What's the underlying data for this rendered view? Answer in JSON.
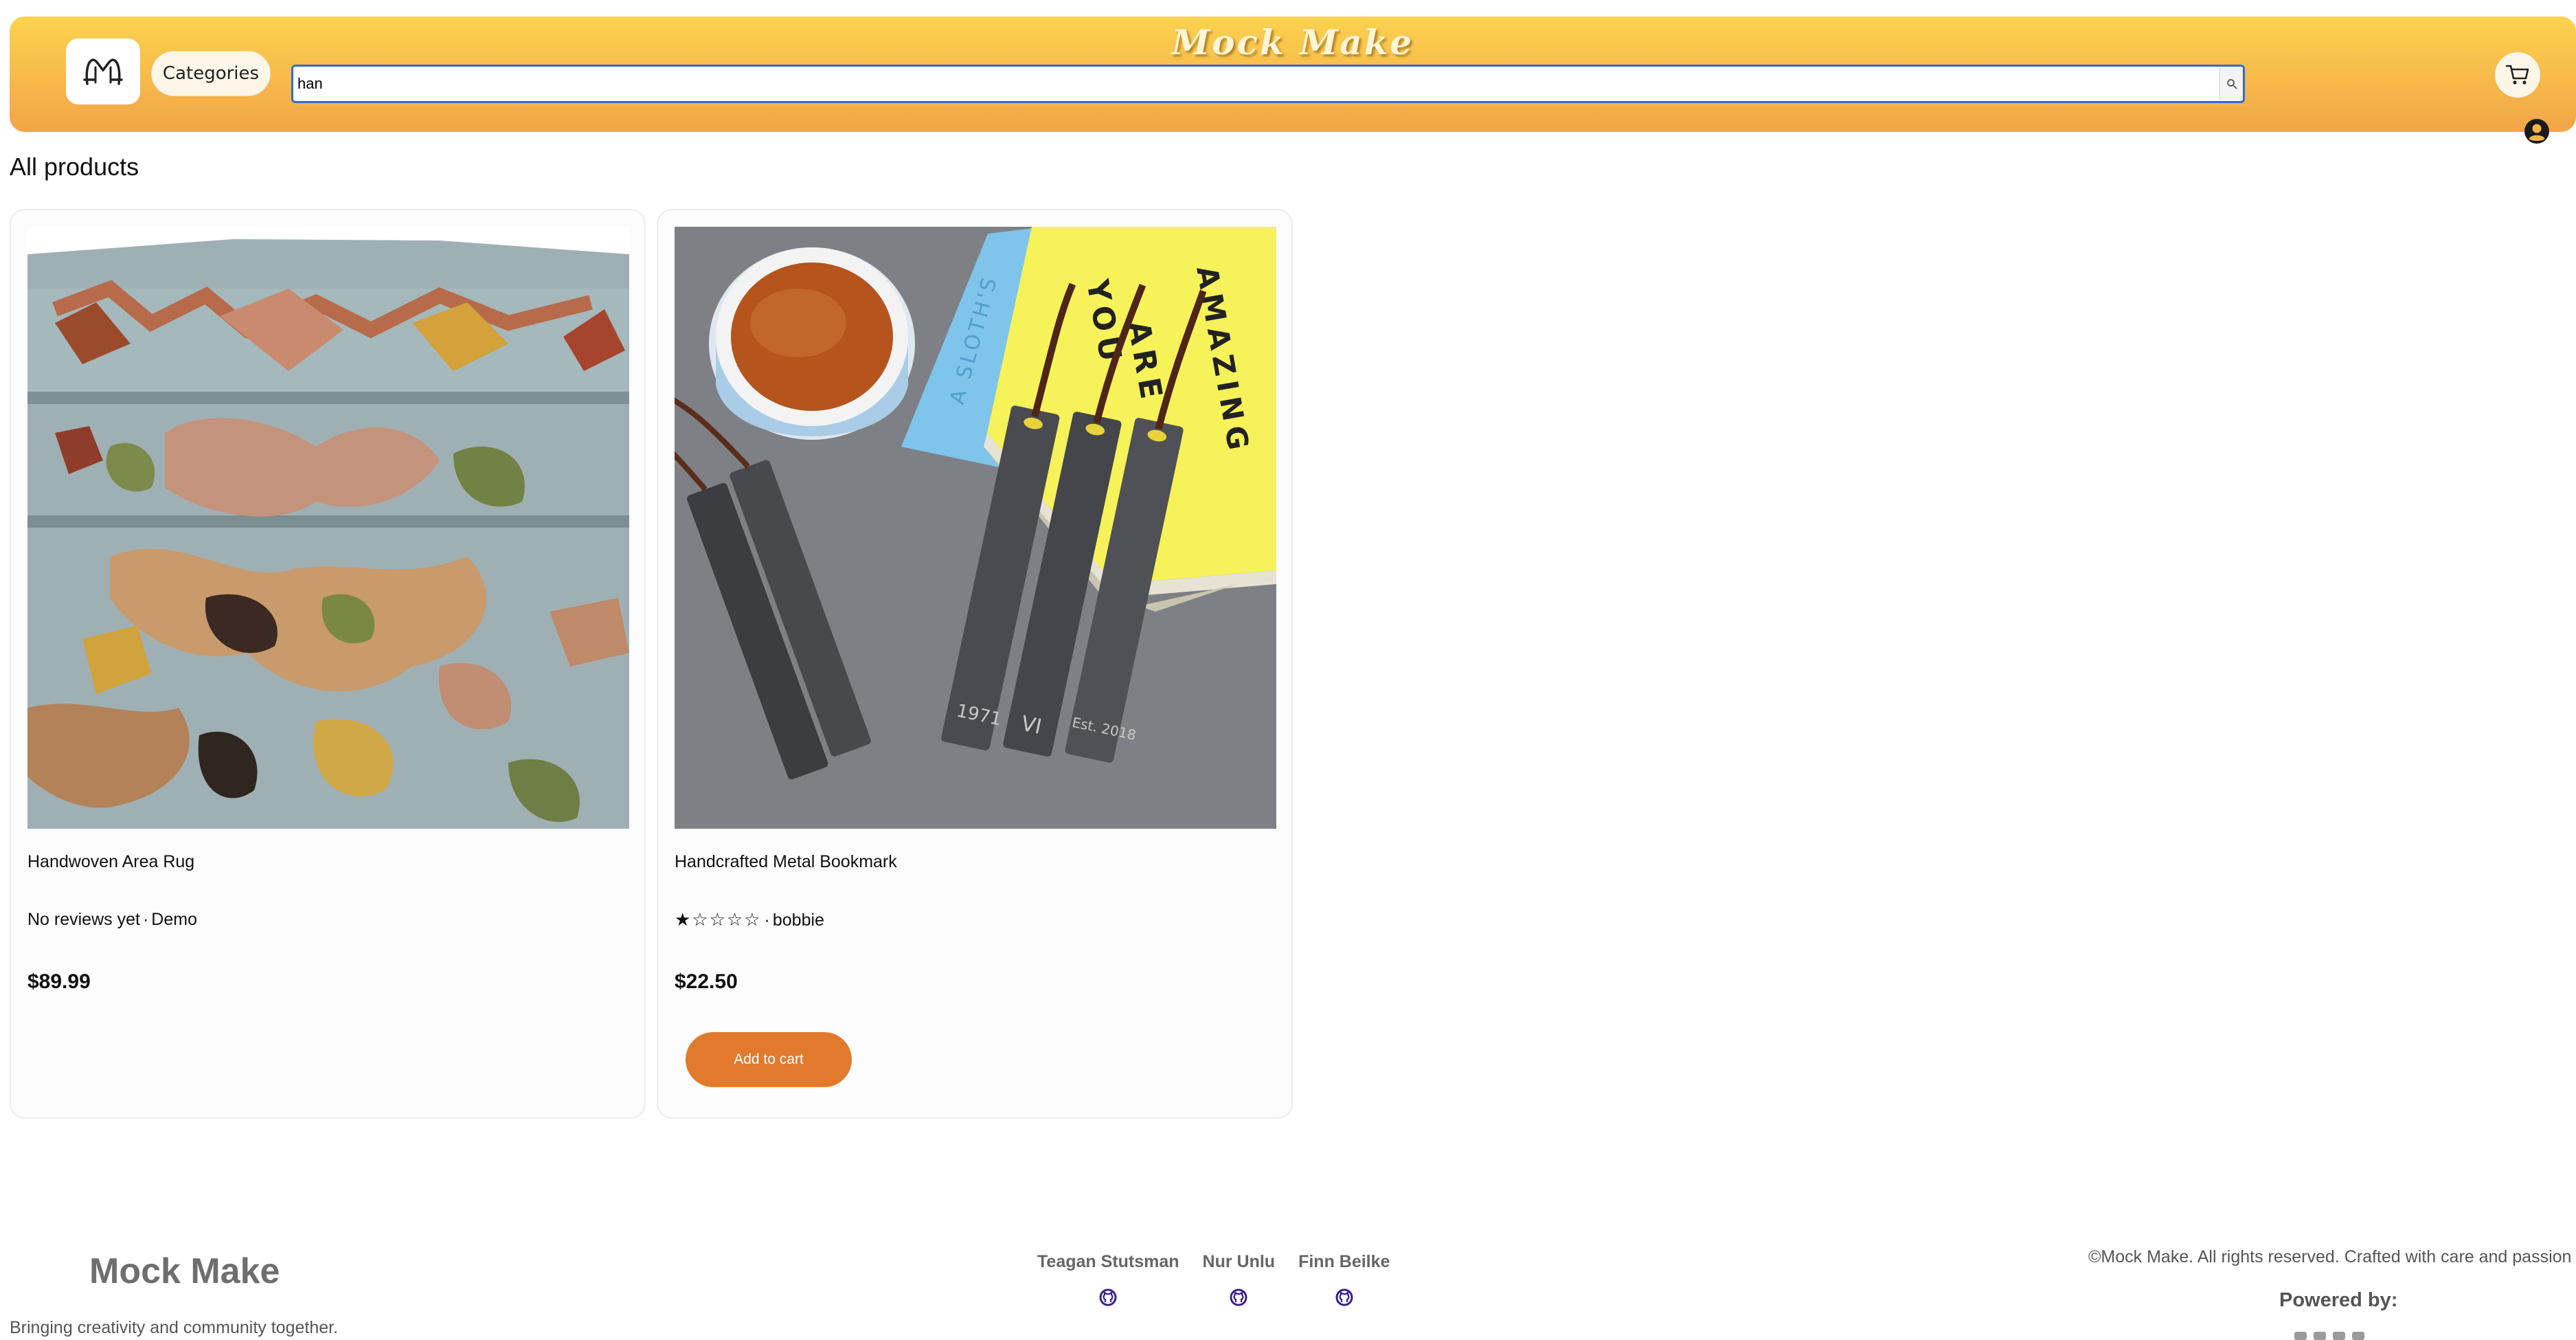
{
  "header": {
    "brand_title": "Mock Make",
    "categories_label": "Categories",
    "search": {
      "value": "han",
      "placeholder": ""
    },
    "icons": {
      "logo": "mock-make-logo",
      "search": "search-icon",
      "cart": "cart-icon",
      "user": "user-circle-icon"
    },
    "gradient": [
      "#fbd34f",
      "#f2a548"
    ]
  },
  "main": {
    "title": "All products",
    "products": [
      {
        "name": "Handwoven Area Rug",
        "reviews": "No reviews yet",
        "seller": "Demo",
        "separator": "·",
        "price": "$89.99",
        "image_icon": "rug-photo"
      },
      {
        "name": "Handcrafted Metal Bookmark",
        "rating": 1,
        "rating_max": 5,
        "stars": "★☆☆☆☆",
        "seller": "bobbie",
        "separator": "·",
        "price": "$22.50",
        "add_to_cart_label": "Add to cart",
        "image_icon": "bookmark-photo",
        "image_text": [
          "YOU",
          "ARE",
          "AMAZING",
          "A SLOTH'S",
          "1971",
          "VI",
          "Est. 2018"
        ]
      }
    ],
    "accent": "#e17a2c"
  },
  "footer": {
    "brand": "Mock Make",
    "tagline": "Bringing creativity and community together.",
    "contributors": [
      {
        "name": "Teagan Stutsman",
        "icon": "github-icon"
      },
      {
        "name": "Nur Unlu",
        "icon": "github-icon"
      },
      {
        "name": "Finn Beilke",
        "icon": "github-icon"
      }
    ],
    "copyright": "©Mock Make. All rights reserved. Crafted with care and passion",
    "powered_by": "Powered by:"
  }
}
